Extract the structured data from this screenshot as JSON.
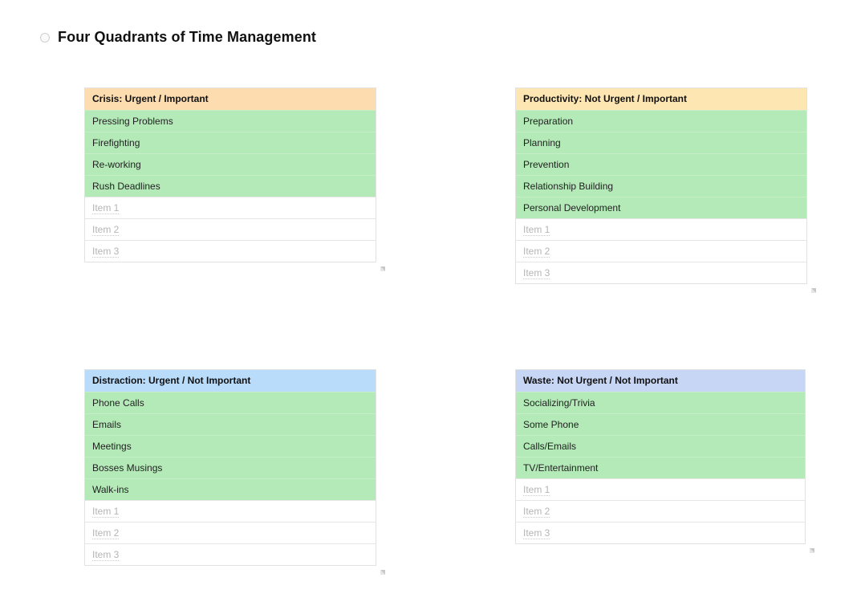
{
  "page": {
    "title": "Four Quadrants of Time Management"
  },
  "colors": {
    "crisis_header": "#fddcb0",
    "productivity_header": "#fde6b2",
    "distraction_header": "#b9dcfb",
    "waste_header": "#c8d6f5",
    "item_fill": "#b3eab7"
  },
  "quadrants": [
    {
      "header": "Crisis: Urgent / Important",
      "items": [
        "Pressing Problems",
        "Firefighting",
        "Re-working",
        "Rush Deadlines"
      ],
      "placeholders": [
        "Item 1",
        "Item 2",
        "Item 3"
      ]
    },
    {
      "header": "Productivity: Not Urgent / Important",
      "items": [
        "Preparation",
        "Planning",
        "Prevention",
        "Relationship Building",
        "Personal Development"
      ],
      "placeholders": [
        "Item 1",
        "Item 2",
        "Item 3"
      ]
    },
    {
      "header": "Distraction: Urgent / Not Important",
      "items": [
        "Phone Calls",
        "Emails",
        "Meetings",
        "Bosses Musings",
        "Walk-ins"
      ],
      "placeholders": [
        "Item 1",
        "Item 2",
        "Item 3"
      ]
    },
    {
      "header": "Waste: Not Urgent / Not Important",
      "items": [
        "Socializing/Trivia",
        "Some Phone",
        "Calls/Emails",
        "TV/Entertainment"
      ],
      "placeholders": [
        "Item 1",
        "Item 2",
        "Item 3"
      ]
    }
  ]
}
